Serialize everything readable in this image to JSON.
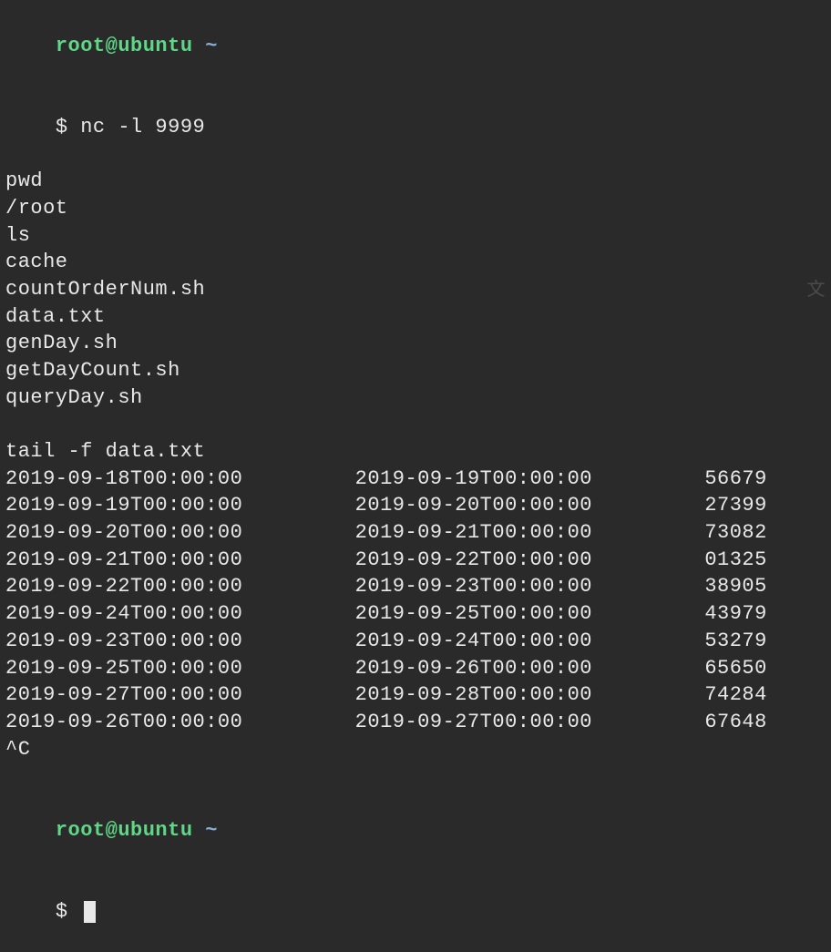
{
  "prompt1": {
    "user": "root",
    "at": "@",
    "host": "ubuntu",
    "tilde": " ~",
    "dollar": "$ ",
    "command": "nc -l 9999"
  },
  "session": {
    "cmd1": "pwd",
    "out1": "/root",
    "cmd2": "ls",
    "files": [
      "cache",
      "countOrderNum.sh",
      "data.txt",
      "genDay.sh",
      "getDayCount.sh",
      "queryDay.sh"
    ],
    "cmd3": "tail -f data.txt",
    "dataRows": [
      {
        "c0": "2019-09-18T00:00:00",
        "c1": "2019-09-19T00:00:00",
        "c2": "56679"
      },
      {
        "c0": "2019-09-19T00:00:00",
        "c1": "2019-09-20T00:00:00",
        "c2": "27399"
      },
      {
        "c0": "2019-09-20T00:00:00",
        "c1": "2019-09-21T00:00:00",
        "c2": "73082"
      },
      {
        "c0": "2019-09-21T00:00:00",
        "c1": "2019-09-22T00:00:00",
        "c2": "01325"
      },
      {
        "c0": "2019-09-22T00:00:00",
        "c1": "2019-09-23T00:00:00",
        "c2": "38905"
      },
      {
        "c0": "2019-09-24T00:00:00",
        "c1": "2019-09-25T00:00:00",
        "c2": "43979"
      },
      {
        "c0": "2019-09-23T00:00:00",
        "c1": "2019-09-24T00:00:00",
        "c2": "53279"
      },
      {
        "c0": "2019-09-25T00:00:00",
        "c1": "2019-09-26T00:00:00",
        "c2": "65650"
      },
      {
        "c0": "2019-09-27T00:00:00",
        "c1": "2019-09-28T00:00:00",
        "c2": "74284"
      },
      {
        "c0": "2019-09-26T00:00:00",
        "c1": "2019-09-27T00:00:00",
        "c2": "67648"
      }
    ],
    "interrupt": "^C"
  },
  "prompt2": {
    "user": "root",
    "at": "@",
    "host": "ubuntu",
    "tilde": " ~",
    "dollar": "$ "
  },
  "watermark": "文"
}
